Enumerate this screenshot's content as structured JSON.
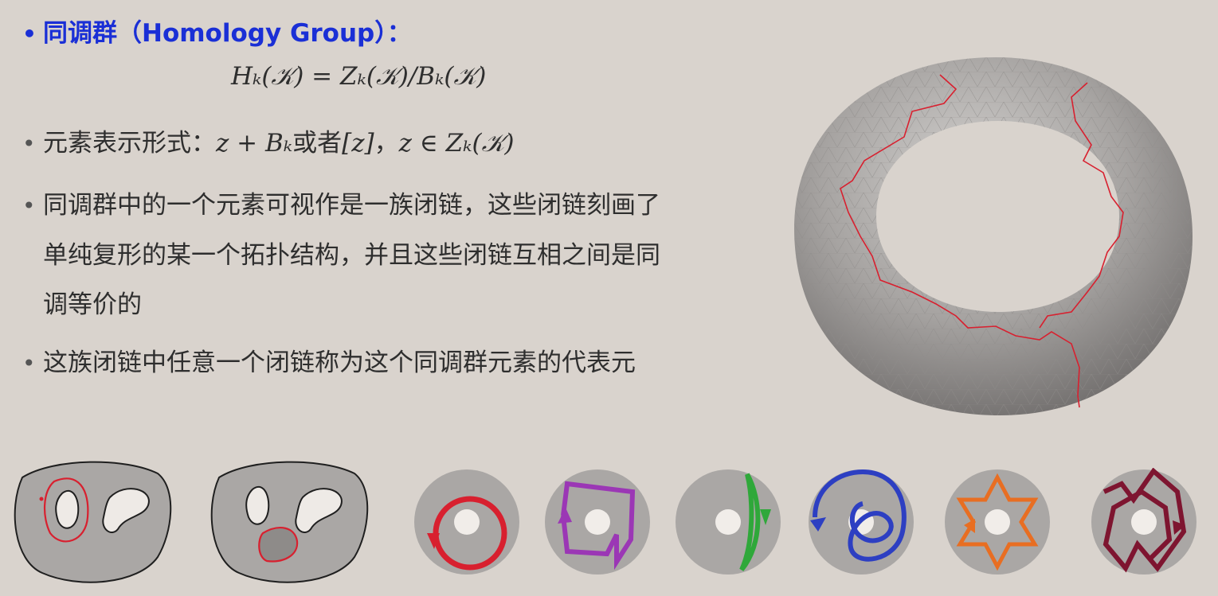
{
  "slide": {
    "title_bullet": "•",
    "title": "同调群（Homology Group）：",
    "formula": "Hₖ(𝒦) = Zₖ(𝒦)/Bₖ(𝒦)",
    "bullets": [
      {
        "marker": "•",
        "text_prefix": "元素表示形式：",
        "math1": "z + Bₖ",
        "text_mid": "或者",
        "math2": "[z]",
        "text_sep": "，",
        "math3": "z ∈ Zₖ(𝒦)"
      },
      {
        "marker": "•",
        "line1": "同调群中的一个元素可视作是一族闭链，这些闭链刻画了",
        "line2": "单纯复形的某一个拓扑结构，并且这些闭链互相之间是同",
        "line3": "调等价的"
      },
      {
        "marker": "•",
        "text": "这族闭链中任意一个闭链称为这个同调群元素的代表元"
      }
    ]
  },
  "colors": {
    "title_blue": "#1a2fd6",
    "cycle_red": "#d8202f",
    "cycle_purple": "#9b37b5",
    "cycle_green": "#2fa83a",
    "cycle_blue": "#2d3fc2",
    "cycle_orange": "#e86e22",
    "cycle_maroon": "#7e1530",
    "surface_gray": "#a9a6a4"
  },
  "figures": {
    "torus_icon": "torus-mesh-with-red-cycle",
    "blobs": [
      "blob-with-red-cycle-around-hole",
      "blob-with-red-boundary-of-filled-region"
    ],
    "annuli": [
      "annulus-red-circle",
      "annulus-purple-zigzag",
      "annulus-green-lens",
      "annulus-blue-loop",
      "annulus-orange-star",
      "annulus-maroon-polygon"
    ]
  }
}
